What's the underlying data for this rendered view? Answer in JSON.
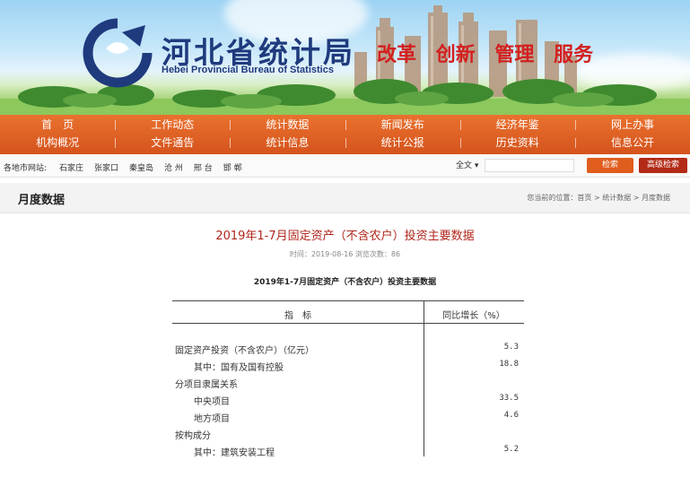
{
  "header": {
    "title": "河北省统计局",
    "subtitle": "Hebei Provincial Bureau of Statistics",
    "slogans": [
      "改革",
      "创新",
      "管理",
      "服务"
    ]
  },
  "nav": {
    "row1": [
      "首　页",
      "工作动态",
      "统计数据",
      "新闻发布",
      "经济年鉴",
      "网上办事"
    ],
    "row2": [
      "机构概况",
      "文件通告",
      "统计信息",
      "统计公报",
      "历史资料",
      "信息公开"
    ]
  },
  "citybar": {
    "label": "各地市网站:",
    "cities": [
      "石家庄",
      "张家口",
      "秦皇岛",
      "沧 州",
      "邢 台",
      "邯 郸"
    ],
    "search_scope": "全文 ▾",
    "search_placeholder": "",
    "search_button": "检索",
    "advanced_button": "高级检索"
  },
  "section": {
    "title": "月度数据",
    "breadcrumb": "您当前的位置：首页 > 统计数据 > 月度数据"
  },
  "article": {
    "title": "2019年1-7月固定资产（不含农户）投资主要数据",
    "meta": "时间：2019-08-16 浏览次数：86",
    "table_caption": "2019年1-7月固定资产（不含农户）投资主要数据",
    "table": {
      "col1": "指　标",
      "col2": "同比增长（%）",
      "rows": [
        {
          "indicator": "固定资产投资（不含农户）（亿元）",
          "indent": 0,
          "value": "5.3"
        },
        {
          "indicator": "其中：国有及国有控股",
          "indent": 1,
          "value": "18.8"
        },
        {
          "indicator": "分项目隶属关系",
          "indent": 0,
          "value": ""
        },
        {
          "indicator": "中央项目",
          "indent": 1,
          "value": "33.5"
        },
        {
          "indicator": "地方项目",
          "indent": 1,
          "value": "4.6"
        },
        {
          "indicator": "按构成分",
          "indent": 0,
          "value": ""
        },
        {
          "indicator": "其中：建筑安装工程",
          "indent": 1,
          "value": "5.2"
        }
      ]
    }
  },
  "colors": {
    "nav_orange": "#e0622a",
    "title_red": "#b0271c",
    "logo_blue": "#1f3a7d"
  }
}
